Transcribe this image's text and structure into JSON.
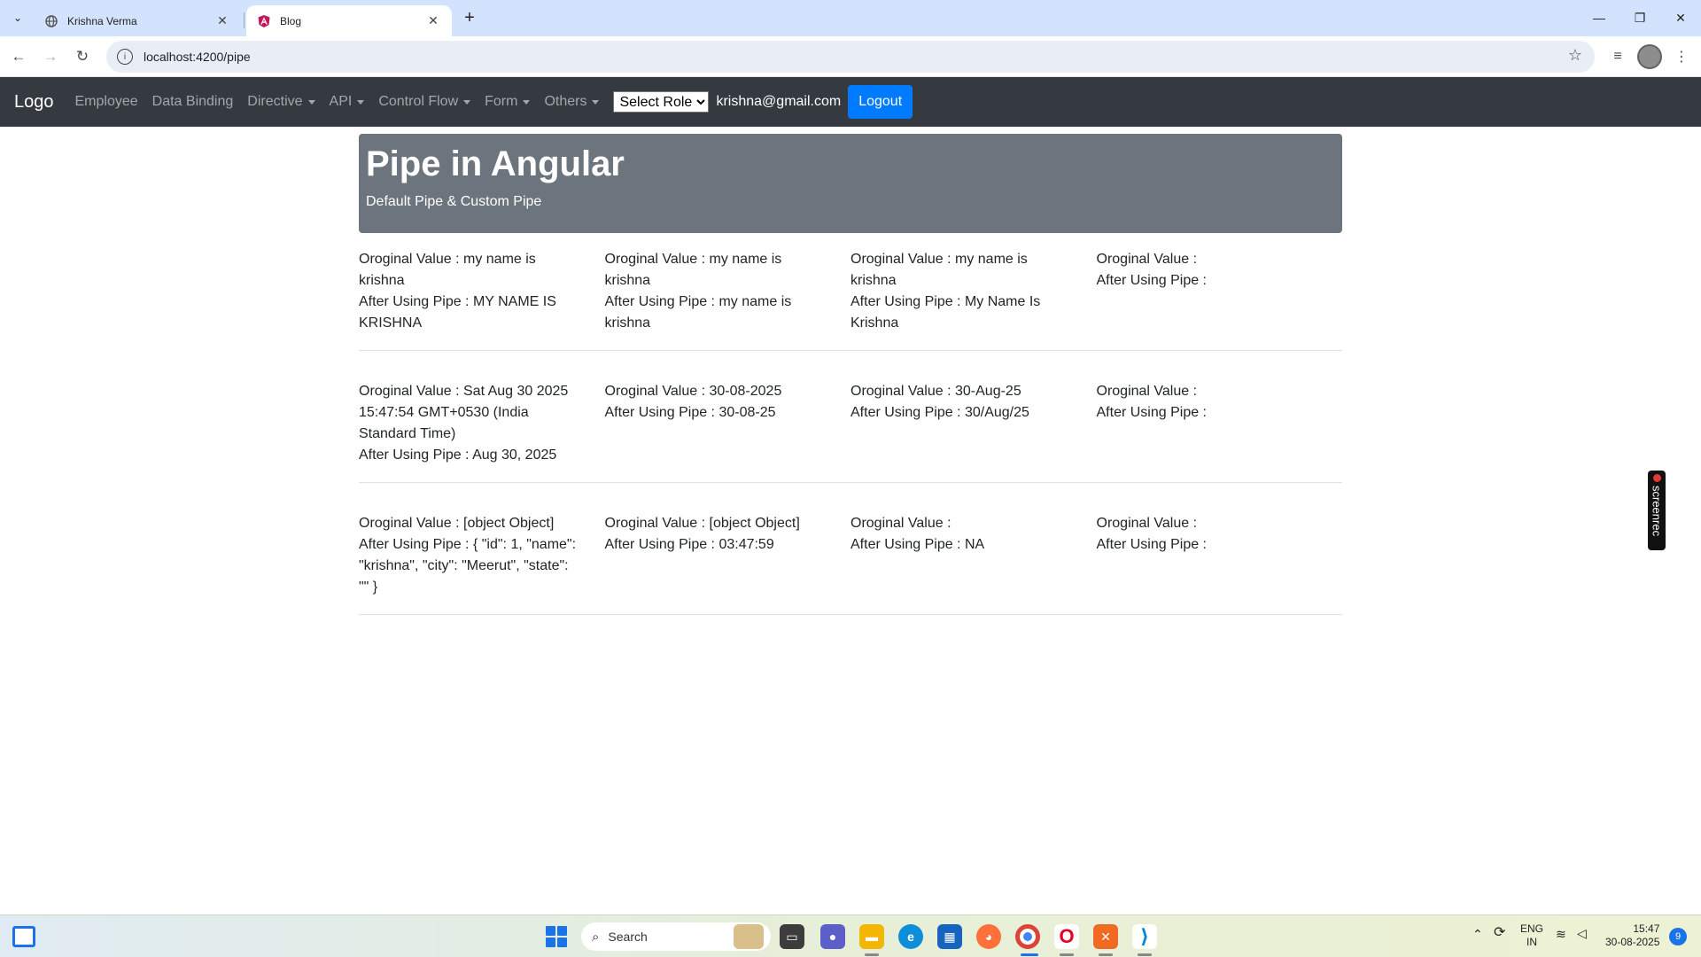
{
  "browser": {
    "tabs": [
      {
        "title": "Krishna Verma",
        "active": false
      },
      {
        "title": "Blog",
        "active": true
      }
    ],
    "url": "localhost:4200/pipe"
  },
  "navbar": {
    "brand": "Logo",
    "links": [
      {
        "label": "Employee",
        "dropdown": false
      },
      {
        "label": "Data Binding",
        "dropdown": false
      },
      {
        "label": "Directive",
        "dropdown": true
      },
      {
        "label": "API",
        "dropdown": true
      },
      {
        "label": "Control Flow",
        "dropdown": true
      },
      {
        "label": "Form",
        "dropdown": true
      },
      {
        "label": "Others",
        "dropdown": true
      }
    ],
    "role_select": {
      "selected": "Select Role"
    },
    "user_email": "krishna@gmail.com",
    "logout_label": "Logout"
  },
  "jumbotron": {
    "title": "Pipe in Angular",
    "subtitle": "Default Pipe & Custom Pipe"
  },
  "rows": [
    [
      {
        "original": "Oroginal Value : my name is krishna",
        "after": "After Using Pipe : MY NAME IS KRISHNA"
      },
      {
        "original": "Oroginal Value : my name is krishna",
        "after": "After Using Pipe : my name is krishna"
      },
      {
        "original": "Oroginal Value : my name is krishna",
        "after": "After Using Pipe : My Name Is Krishna"
      },
      {
        "original": "Oroginal Value :",
        "after": "After Using Pipe :"
      }
    ],
    [
      {
        "original": "Oroginal Value : Sat Aug 30 2025 15:47:54 GMT+0530 (India Standard Time)",
        "after": "After Using Pipe : Aug 30, 2025"
      },
      {
        "original": "Oroginal Value : 30-08-2025",
        "after": "After Using Pipe : 30-08-25"
      },
      {
        "original": "Oroginal Value : 30-Aug-25",
        "after": "After Using Pipe : 30/Aug/25"
      },
      {
        "original": "Oroginal Value :",
        "after": "After Using Pipe :"
      }
    ],
    [
      {
        "original": "Oroginal Value : [object Object]",
        "after": "After Using Pipe : { \"id\": 1, \"name\": \"krishna\", \"city\": \"Meerut\", \"state\": \"\" }"
      },
      {
        "original": "Oroginal Value : [object Object]",
        "after": "After Using Pipe : 03:47:59"
      },
      {
        "original": "Oroginal Value :",
        "after": "After Using Pipe : NA"
      },
      {
        "original": "Oroginal Value :",
        "after": "After Using Pipe :"
      }
    ]
  ],
  "screenrec_label": "screenrec",
  "taskbar": {
    "search_placeholder": "Search",
    "language": "ENG",
    "region": "IN",
    "time": "15:47",
    "date": "30-08-2025",
    "notification_count": "9"
  }
}
